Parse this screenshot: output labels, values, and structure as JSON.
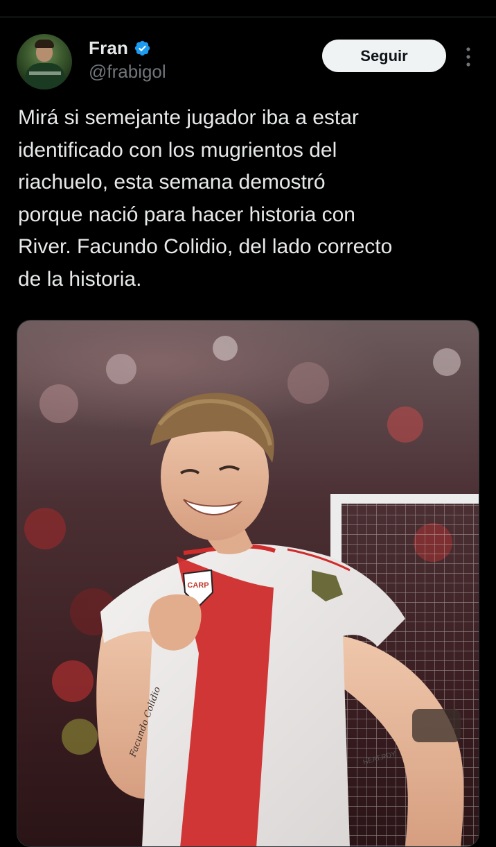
{
  "author": {
    "display_name": "Fran",
    "handle": "@frabigol",
    "verified": true,
    "verified_color": "#1d9bf0"
  },
  "actions": {
    "follow_label": "Seguir",
    "more_icon": "more-vertical-icon"
  },
  "post": {
    "text_lines": [
      "Mirá si semejante jugador iba a estar",
      "identificado con los mugrientos del",
      "riachuelo, esta semana demostró",
      "porque nació para hacer historia con",
      "River. Facundo Colidio, del lado correcto",
      "de la historia."
    ]
  },
  "media": {
    "kind": "photo",
    "shirt_crest_text": "CARP",
    "tattoo_text": "Facundo Colidio",
    "shirt_brand_text": "HEAT.RDY"
  },
  "colors": {
    "background": "#000000",
    "text": "#e7e9ea",
    "secondary_text": "#71767b",
    "button_bg": "#eff3f4",
    "button_text": "#0f1419"
  }
}
